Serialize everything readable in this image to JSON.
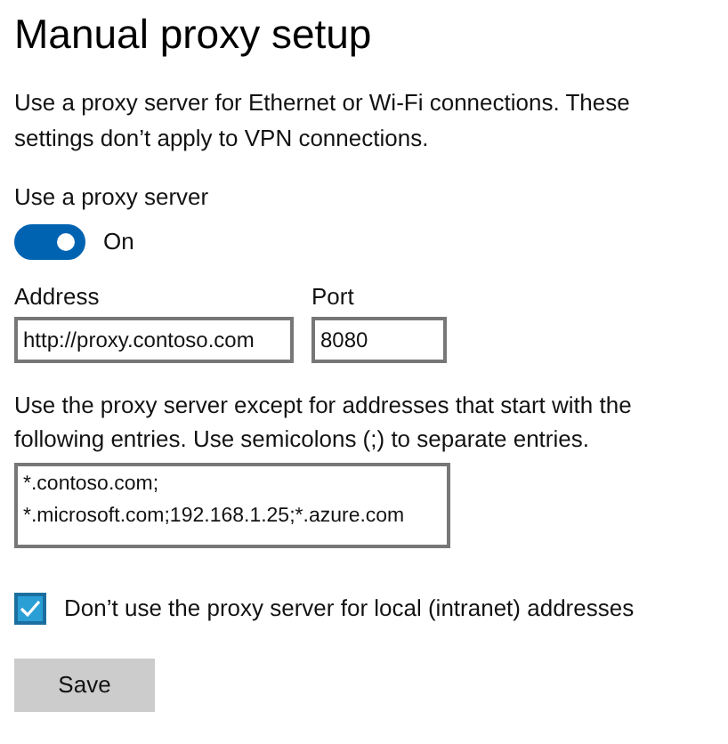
{
  "title": "Manual proxy setup",
  "description": "Use a proxy server for Ethernet or Wi-Fi connections. These settings don’t apply to VPN connections.",
  "proxy_toggle": {
    "label": "Use a proxy server",
    "on": true,
    "state_text": "On"
  },
  "address": {
    "label": "Address",
    "value": "http://proxy.contoso.com"
  },
  "port": {
    "label": "Port",
    "value": "8080"
  },
  "exceptions": {
    "label": "Use the proxy server except for addresses that start with the following entries. Use semicolons (;) to separate entries.",
    "lines": [
      "*.contoso.com;",
      "*.microsoft.com;192.168.1.25;*.azure.com"
    ]
  },
  "local_bypass": {
    "label": "Don’t use the proxy server for local (intranet) addresses",
    "checked": true
  },
  "save_button": "Save"
}
